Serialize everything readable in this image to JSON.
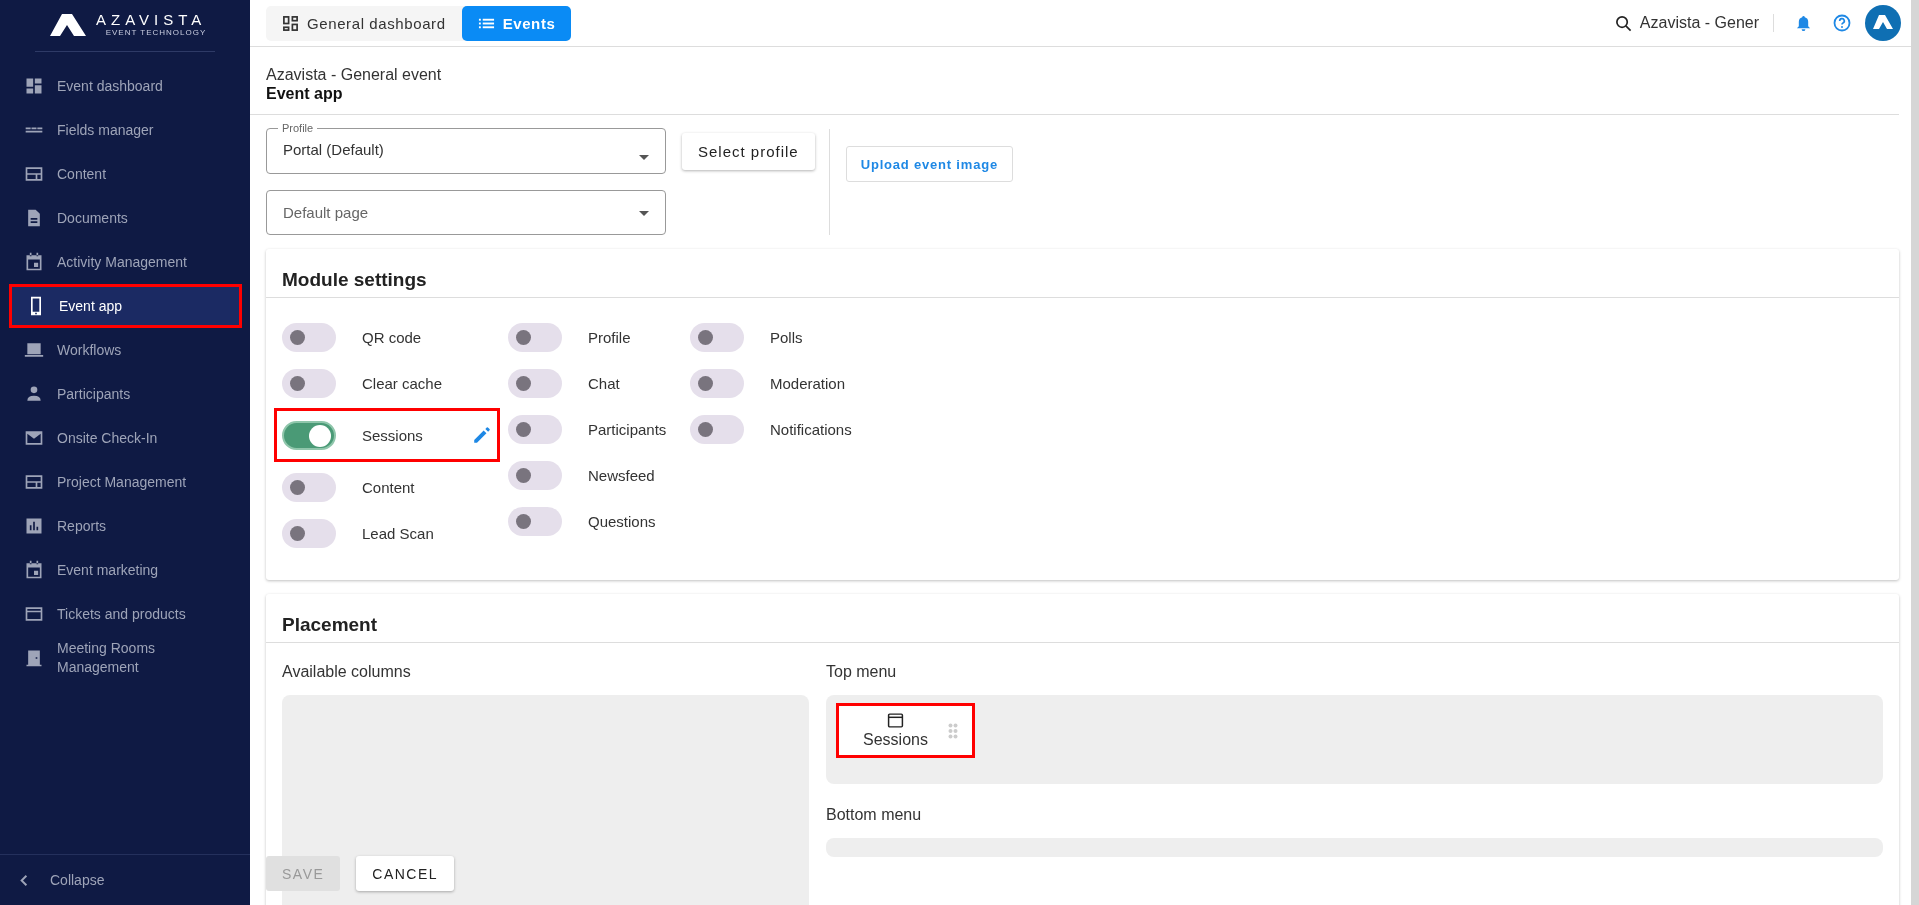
{
  "sidebar": {
    "logo": {
      "name": "AZAVISTA",
      "tagline": "EVENT TECHNOLOGY"
    },
    "items": [
      {
        "label": "Event dashboard",
        "selected": false,
        "highlighted": false
      },
      {
        "label": "Fields manager",
        "selected": false,
        "highlighted": false
      },
      {
        "label": "Content",
        "selected": false,
        "highlighted": false
      },
      {
        "label": "Documents",
        "selected": false,
        "highlighted": false
      },
      {
        "label": "Activity Management",
        "selected": false,
        "highlighted": false
      },
      {
        "label": "Event app",
        "selected": true,
        "highlighted": true
      },
      {
        "label": "Workflows",
        "selected": false,
        "highlighted": false
      },
      {
        "label": "Participants",
        "selected": false,
        "highlighted": false
      },
      {
        "label": "Onsite Check-In",
        "selected": false,
        "highlighted": false
      },
      {
        "label": "Project Management",
        "selected": false,
        "highlighted": false
      },
      {
        "label": "Reports",
        "selected": false,
        "highlighted": false
      },
      {
        "label": "Event marketing",
        "selected": false,
        "highlighted": false
      },
      {
        "label": "Tickets and products",
        "selected": false,
        "highlighted": false
      },
      {
        "label": "Meeting Rooms Management",
        "selected": false,
        "highlighted": false
      }
    ],
    "collapse": "Collapse"
  },
  "topbar": {
    "tabs": [
      {
        "label": "General dashboard",
        "selected": false
      },
      {
        "label": "Events",
        "selected": true
      }
    ],
    "search_value": "Azavista - Gener"
  },
  "page": {
    "breadcrumb": "Azavista - General event",
    "title": "Event app"
  },
  "profile_field": {
    "label": "Profile",
    "value": "Portal (Default)"
  },
  "select_profile_button": "Select profile",
  "default_page_field": {
    "placeholder": "Default page"
  },
  "upload_button": "Upload event image",
  "module_settings": {
    "title": "Module settings",
    "columns": [
      [
        {
          "label": "QR code",
          "on": false,
          "highlighted": false,
          "editable": false
        },
        {
          "label": "Clear cache",
          "on": false,
          "highlighted": false,
          "editable": false
        },
        {
          "label": "Sessions",
          "on": true,
          "highlighted": true,
          "editable": true
        },
        {
          "label": "Content",
          "on": false,
          "highlighted": false,
          "editable": false
        },
        {
          "label": "Lead Scan",
          "on": false,
          "highlighted": false,
          "editable": false
        }
      ],
      [
        {
          "label": "Profile",
          "on": false,
          "highlighted": false,
          "editable": false
        },
        {
          "label": "Chat",
          "on": false,
          "highlighted": false,
          "editable": false
        },
        {
          "label": "Participants",
          "on": false,
          "highlighted": false,
          "editable": false
        },
        {
          "label": "Newsfeed",
          "on": false,
          "highlighted": false,
          "editable": false
        },
        {
          "label": "Questions",
          "on": false,
          "highlighted": false,
          "editable": false
        }
      ],
      [
        {
          "label": "Polls",
          "on": false,
          "highlighted": false,
          "editable": false
        },
        {
          "label": "Moderation",
          "on": false,
          "highlighted": false,
          "editable": false
        },
        {
          "label": "Notifications",
          "on": false,
          "highlighted": false,
          "editable": false
        }
      ]
    ]
  },
  "placement": {
    "title": "Placement",
    "available": {
      "label": "Available columns"
    },
    "top_menu": {
      "label": "Top menu",
      "items": [
        {
          "label": "Sessions",
          "highlighted": true
        }
      ]
    },
    "bottom_menu": {
      "label": "Bottom menu"
    }
  },
  "actions": {
    "save": {
      "label": "SAVE",
      "disabled": true
    },
    "cancel": {
      "label": "CANCEL",
      "disabled": false
    }
  }
}
